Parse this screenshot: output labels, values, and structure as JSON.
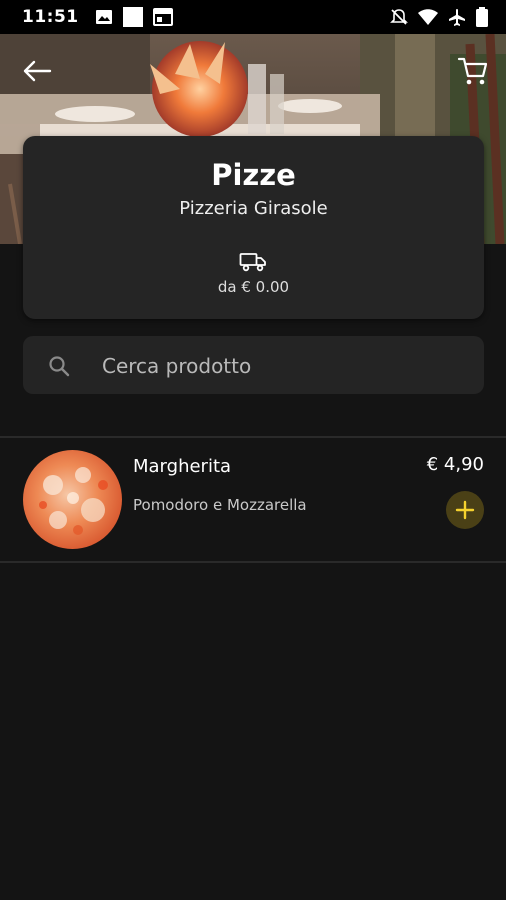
{
  "status_bar": {
    "time": "11:51",
    "icons": [
      "image-icon",
      "square-icon",
      "calendar-icon",
      "notifications-off-icon",
      "wifi-icon",
      "airplane-icon",
      "battery-icon"
    ]
  },
  "header": {
    "title": "Pizze",
    "subtitle": "Pizzeria Girasole",
    "delivery_text": "da € 0.00"
  },
  "search": {
    "placeholder": "Cerca prodotto"
  },
  "products": [
    {
      "name": "Margherita",
      "description": "Pomodoro e Mozzarella",
      "price": "€ 4,90"
    }
  ],
  "colors": {
    "background": "#141414",
    "card": "#252525",
    "accent": "#f5d22e",
    "add_button_bg": "#4a4016"
  }
}
